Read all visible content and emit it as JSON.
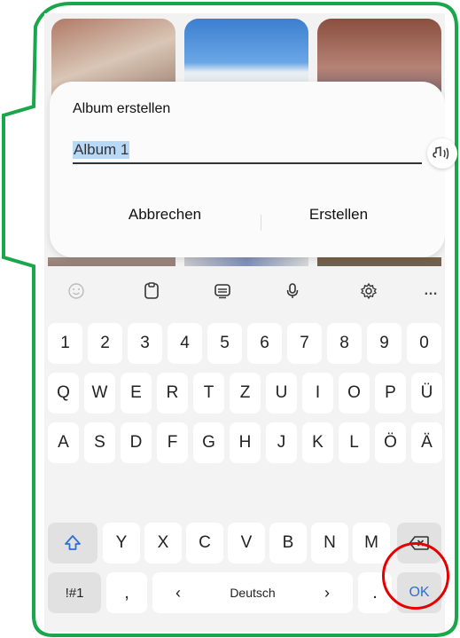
{
  "dialog": {
    "title": "Album erstellen",
    "album_name_value": "Album 1",
    "cancel_label": "Abbrechen",
    "create_label": "Erstellen",
    "voice_icon": "voice-input-icon"
  },
  "keyboard": {
    "toolbar": {
      "emoji_icon": "emoji-icon",
      "clipboard_icon": "clipboard-icon",
      "keyboard_icon": "keyboard-mode-icon",
      "mic_icon": "microphone-icon",
      "settings_icon": "settings-icon",
      "more_label": "…"
    },
    "row_numbers": [
      "1",
      "2",
      "3",
      "4",
      "5",
      "6",
      "7",
      "8",
      "9",
      "0"
    ],
    "row_q": [
      "Q",
      "W",
      "E",
      "R",
      "T",
      "Z",
      "U",
      "I",
      "O",
      "P",
      "Ü"
    ],
    "row_a": [
      "A",
      "S",
      "D",
      "F",
      "G",
      "H",
      "J",
      "K",
      "L",
      "Ö",
      "Ä"
    ],
    "row_y": [
      "Y",
      "X",
      "C",
      "V",
      "B",
      "N",
      "M"
    ],
    "symbols_label": "!#1",
    "comma_label": ",",
    "space_label": "Deutsch",
    "space_left_arrow": "‹",
    "space_right_arrow": "›",
    "period_label": ".",
    "ok_label": "OK",
    "shift_icon": "shift-icon",
    "backspace_icon": "backspace-icon"
  },
  "colors": {
    "frame": "#1aa64a",
    "accent": "#2d6fd6",
    "highlight_circle": "#e60000"
  }
}
